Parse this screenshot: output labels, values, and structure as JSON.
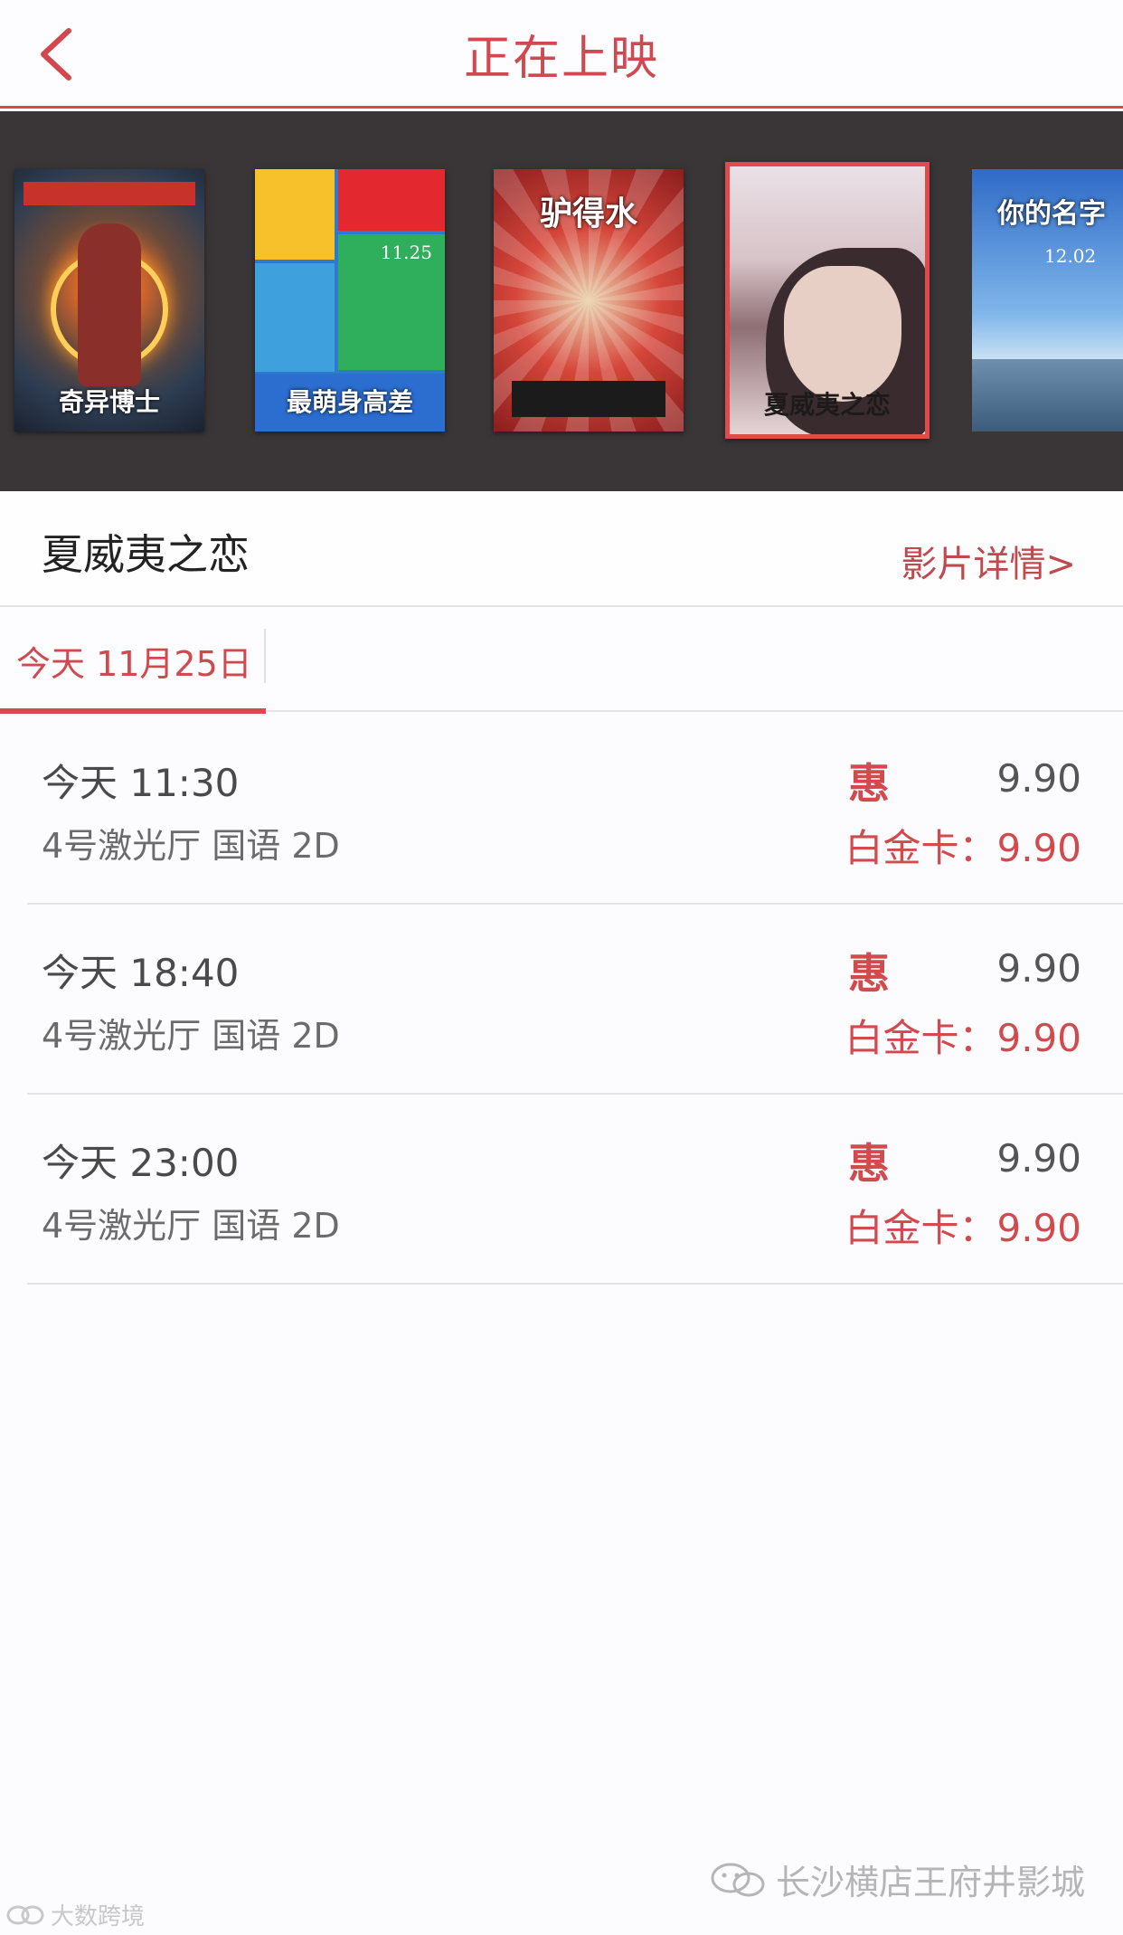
{
  "header": {
    "title": "正在上映",
    "back_icon": "chevron-left-icon",
    "accent_color": "#d2484d"
  },
  "posters": [
    {
      "id": "doctor-strange",
      "title": "奇异博士",
      "selected": false
    },
    {
      "id": "mr-and-mrs",
      "title": "最萌身高差",
      "date": "11.25",
      "selected": false
    },
    {
      "id": "mr-donkey",
      "title": "驴得水",
      "selected": false
    },
    {
      "id": "pali-road",
      "title": "夏威夷之恋",
      "selected": true
    },
    {
      "id": "your-name",
      "title": "你的名字",
      "date": "12.02",
      "selected": false
    }
  ],
  "movie": {
    "title": "夏威夷之恋",
    "detail_link": "影片详情>"
  },
  "date_tabs": [
    {
      "label": "今天 11月25日",
      "active": true
    }
  ],
  "showtimes": [
    {
      "time": "今天 11:30",
      "hall": "4号激光厅 国语 2D",
      "badge": "惠",
      "price": "9.90",
      "member_price": "白金卡：9.90"
    },
    {
      "time": "今天 18:40",
      "hall": "4号激光厅 国语 2D",
      "badge": "惠",
      "price": "9.90",
      "member_price": "白金卡：9.90"
    },
    {
      "time": "今天 23:00",
      "hall": "4号激光厅 国语 2D",
      "badge": "惠",
      "price": "9.90",
      "member_price": "白金卡：9.90"
    }
  ],
  "watermarks": {
    "right": "长沙横店王府井影城",
    "left": "大数跨境"
  }
}
